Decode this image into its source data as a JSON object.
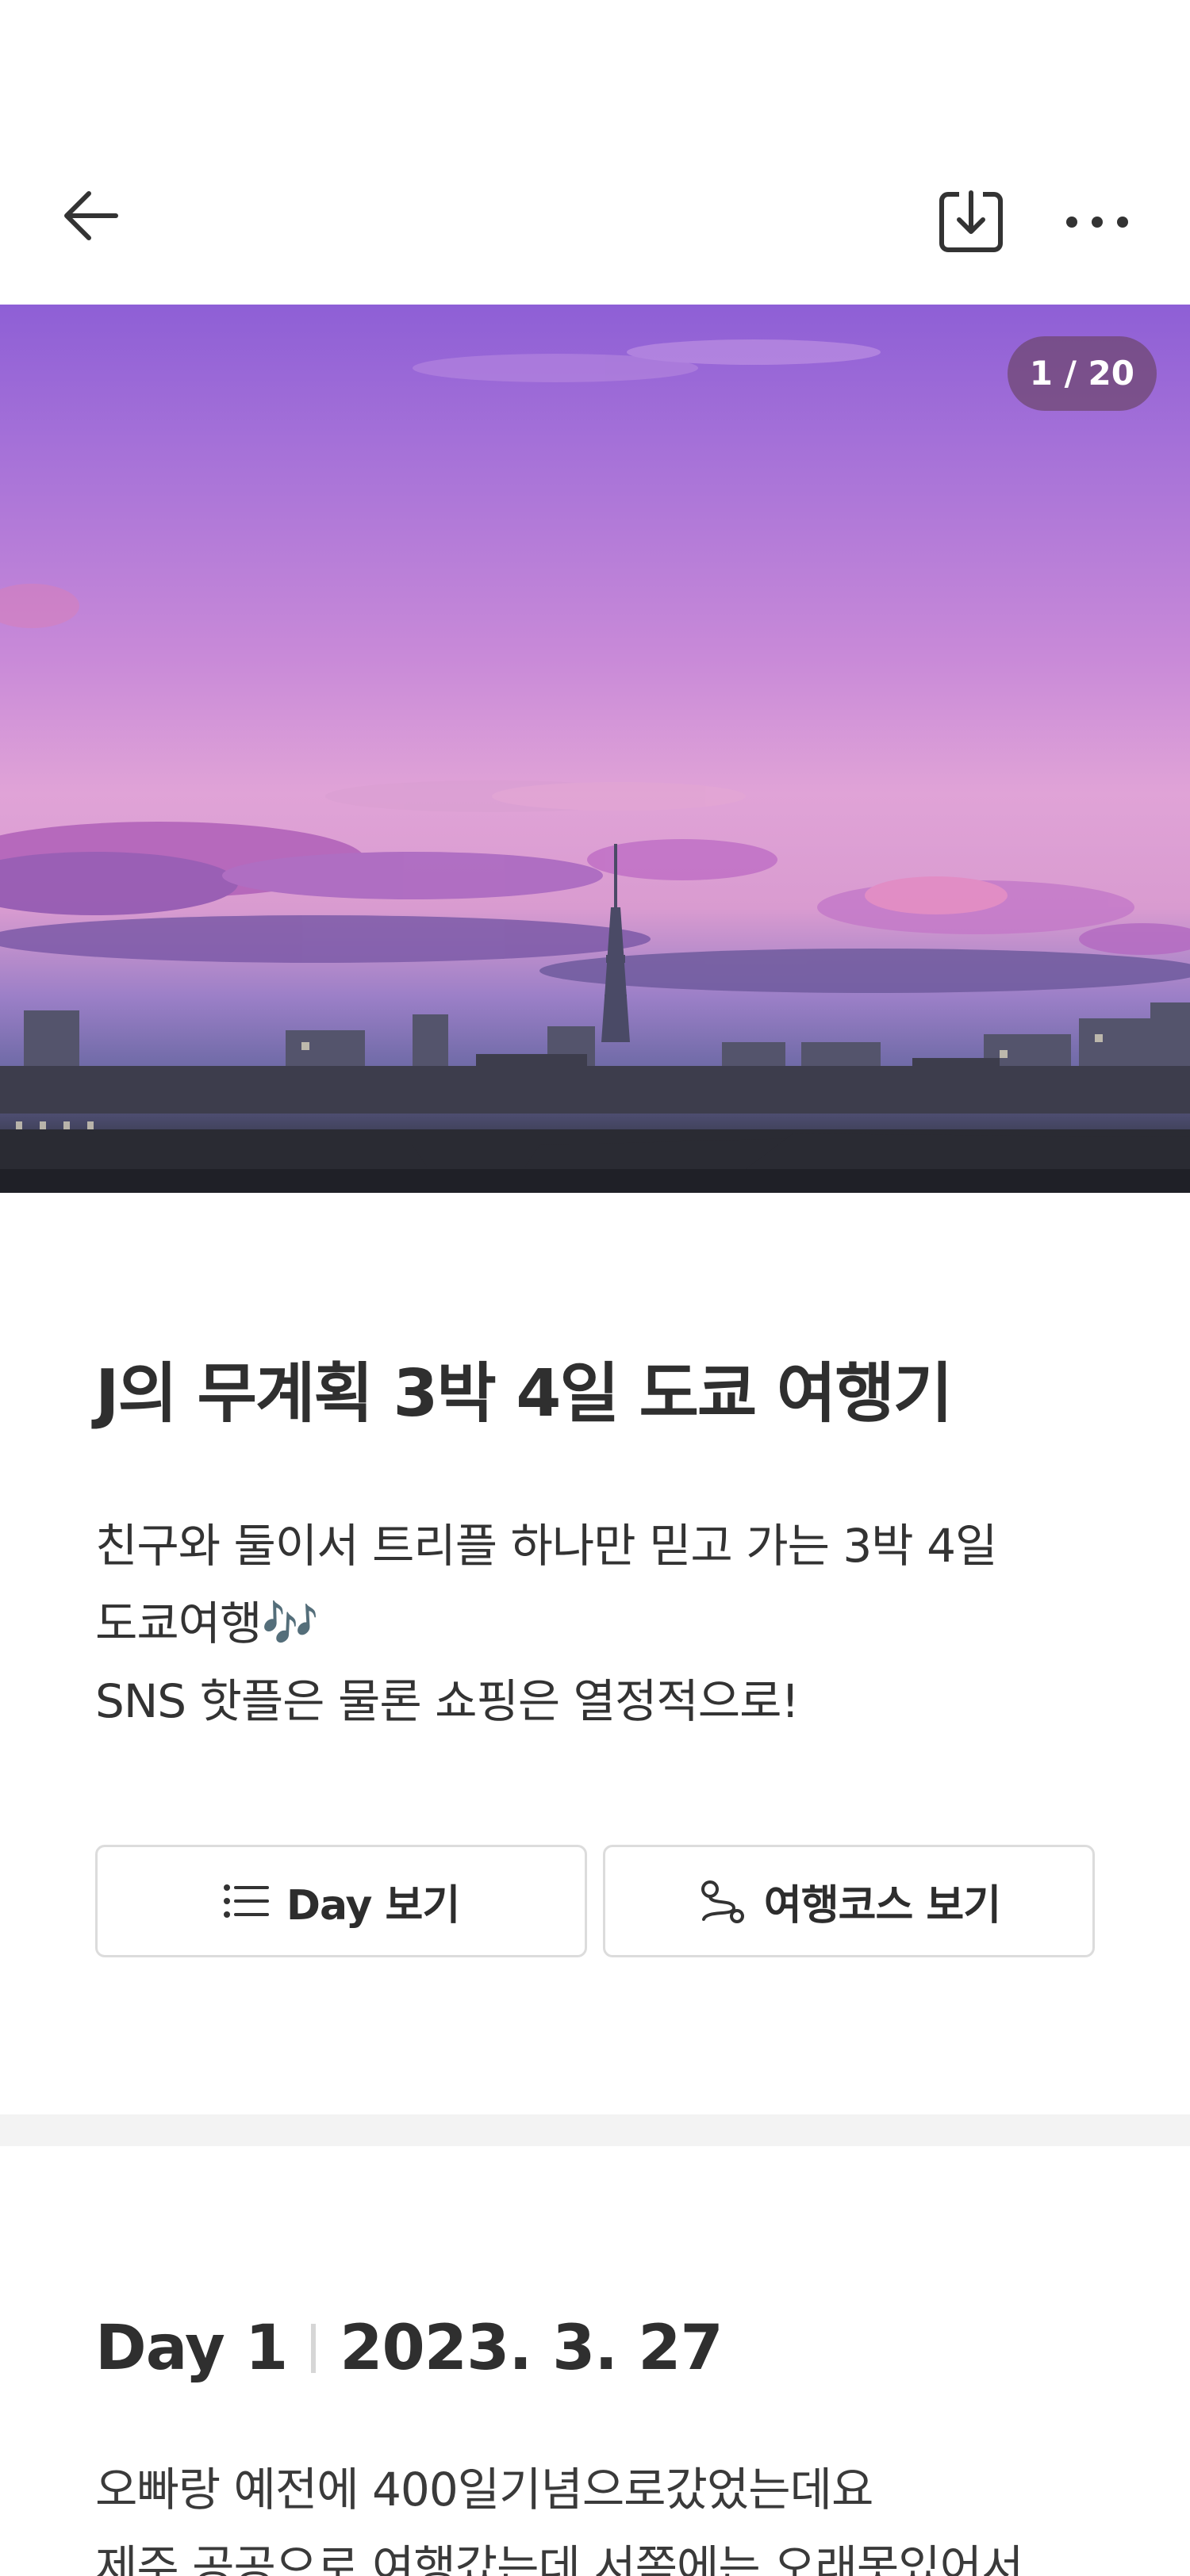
{
  "header": {
    "back_icon": "arrow-left-icon",
    "download_icon": "download-icon",
    "more_icon": "more-horizontal-icon"
  },
  "hero": {
    "counter": "1 / 20",
    "description": "Purple and pink sunset sky over a city skyline with a tall broadcast tower"
  },
  "trip": {
    "title": "J의 무계획 3박 4일 도쿄 여행기",
    "description_lines": [
      "친구와 둘이서 트리플 하나만 믿고 가는 3박 4일",
      "도쿄여행🎶",
      "SNS 핫플은 물론 쇼핑은 열정적으로!"
    ]
  },
  "actions": {
    "day_view_label": "Day 보기",
    "day_view_icon": "list-icon",
    "course_view_label": "여행코스 보기",
    "course_view_icon": "route-icon"
  },
  "day": {
    "label": "Day 1",
    "date": "2023. 3. 27",
    "body_lines": [
      "오빠랑 예전에 400일기념으로갔었는데요",
      "제주 공공으로 여행갔는데 서쪽에는 오래못있어서"
    ]
  }
}
